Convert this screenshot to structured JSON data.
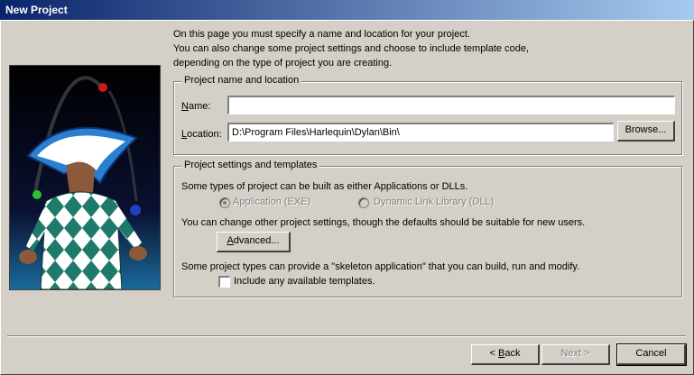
{
  "window": {
    "title": "New Project"
  },
  "intro": {
    "line1": "On this page you must specify a name and location for your project.",
    "line2": "You can also change some project settings and choose to include template code,",
    "line3": "depending on the type of project you are creating."
  },
  "name_location": {
    "legend": "Project name and location",
    "name_label_u": "N",
    "name_label_rest": "ame:",
    "name_value": "",
    "location_label_u": "L",
    "location_label_rest": "ocation:",
    "location_value": "D:\\Program Files\\Harlequin\\Dylan\\Bin\\",
    "browse_label": "Browse..."
  },
  "settings": {
    "legend": "Project settings and templates",
    "types_text": "Some types of project can be built as either Applications or DLLs.",
    "radio_app": "Application (EXE)",
    "radio_dll": "Dynamic Link Library (DLL)",
    "other_text": "You can change other project settings, though the defaults should be suitable for new users.",
    "advanced_u": "A",
    "advanced_rest": "dvanced...",
    "skeleton_text": "Some project types can provide a \"skeleton application\" that you can build, run and modify.",
    "include_label": "Include any available templates."
  },
  "footer": {
    "back_prefix": "< ",
    "back_u": "B",
    "back_rest": "ack",
    "next_label": "Next >",
    "cancel_label": "Cancel"
  },
  "icons": [
    "juggler-illustration"
  ],
  "colors": {
    "titlebar_start": "#0a246a",
    "titlebar_end": "#a6caf0",
    "dialog_face": "#d4d0c8"
  }
}
